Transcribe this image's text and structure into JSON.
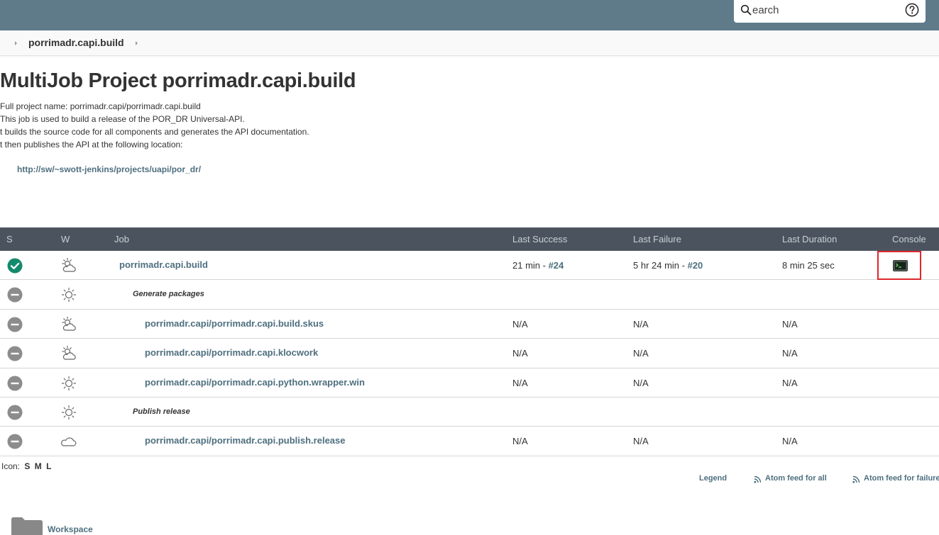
{
  "header": {
    "search_placeholder": "Search",
    "search_value": "earch",
    "search_icon": "search-icon",
    "help_icon": "help-icon"
  },
  "breadcrumb": {
    "items": [
      "porrimadr.capi.build"
    ]
  },
  "page": {
    "title": "MultiJob Project porrimadr.capi.build",
    "description_lines": [
      "Full project name: porrimadr.capi/porrimadr.capi.build",
      "This job is used to build a release of the POR_DR Universal-API.",
      "t builds the source code for all components and generates the API documentation.",
      "t then publishes the API at the following location:"
    ],
    "doc_link": "http://sw/~swott-jenkins/projects/uapi/por_dr/"
  },
  "table": {
    "headers": {
      "s": "S",
      "w": "W",
      "job": "Job",
      "last_success": "Last Success",
      "last_failure": "Last Failure",
      "last_duration": "Last Duration",
      "console": "Console"
    },
    "rows": [
      {
        "status": "success-icon",
        "weather": "cloudy-sun-icon",
        "name": "porrimadr.capi.build",
        "last_success_time": "21 min - ",
        "last_success_build": "#24",
        "last_failure_time": "5 hr 24 min - ",
        "last_failure_build": "#20",
        "last_duration": "8 min 25 sec",
        "console": "console-icon"
      },
      {
        "status": "disabled-icon",
        "weather": "sunny-icon",
        "phase": "Generate packages"
      },
      {
        "status": "disabled-icon",
        "weather": "cloudy-sun-icon",
        "name": "porrimadr.capi/porrimadr.capi.build.skus",
        "last_success": "N/A",
        "last_failure": "N/A",
        "last_duration": "N/A"
      },
      {
        "status": "disabled-icon",
        "weather": "cloudy-sun-icon",
        "name": "porrimadr.capi/porrimadr.capi.klocwork",
        "last_success": "N/A",
        "last_failure": "N/A",
        "last_duration": "N/A"
      },
      {
        "status": "disabled-icon",
        "weather": "sunny-icon",
        "name": "porrimadr.capi/porrimadr.capi.python.wrapper.win",
        "last_success": "N/A",
        "last_failure": "N/A",
        "last_duration": "N/A"
      },
      {
        "status": "disabled-icon",
        "weather": "sunny-icon",
        "phase": "Publish release"
      },
      {
        "status": "disabled-icon",
        "weather": "cloud-icon",
        "name": "porrimadr.capi/porrimadr.capi.publish.release",
        "last_success": "N/A",
        "last_failure": "N/A",
        "last_duration": "N/A"
      }
    ]
  },
  "footer": {
    "icon_label": "Icon:",
    "icon_sizes": [
      "S",
      "M",
      "L"
    ],
    "legend": "Legend",
    "atom_all": "Atom feed for all",
    "atom_failures": "Atom feed for failures",
    "workspace": "Workspace"
  },
  "colors": {
    "header_bg": "#5f7b89",
    "table_header_bg": "#4b545e",
    "link": "#4e6f7f",
    "success": "#138a6b",
    "disabled": "#8c8c8c",
    "highlight": "#e0262d"
  }
}
